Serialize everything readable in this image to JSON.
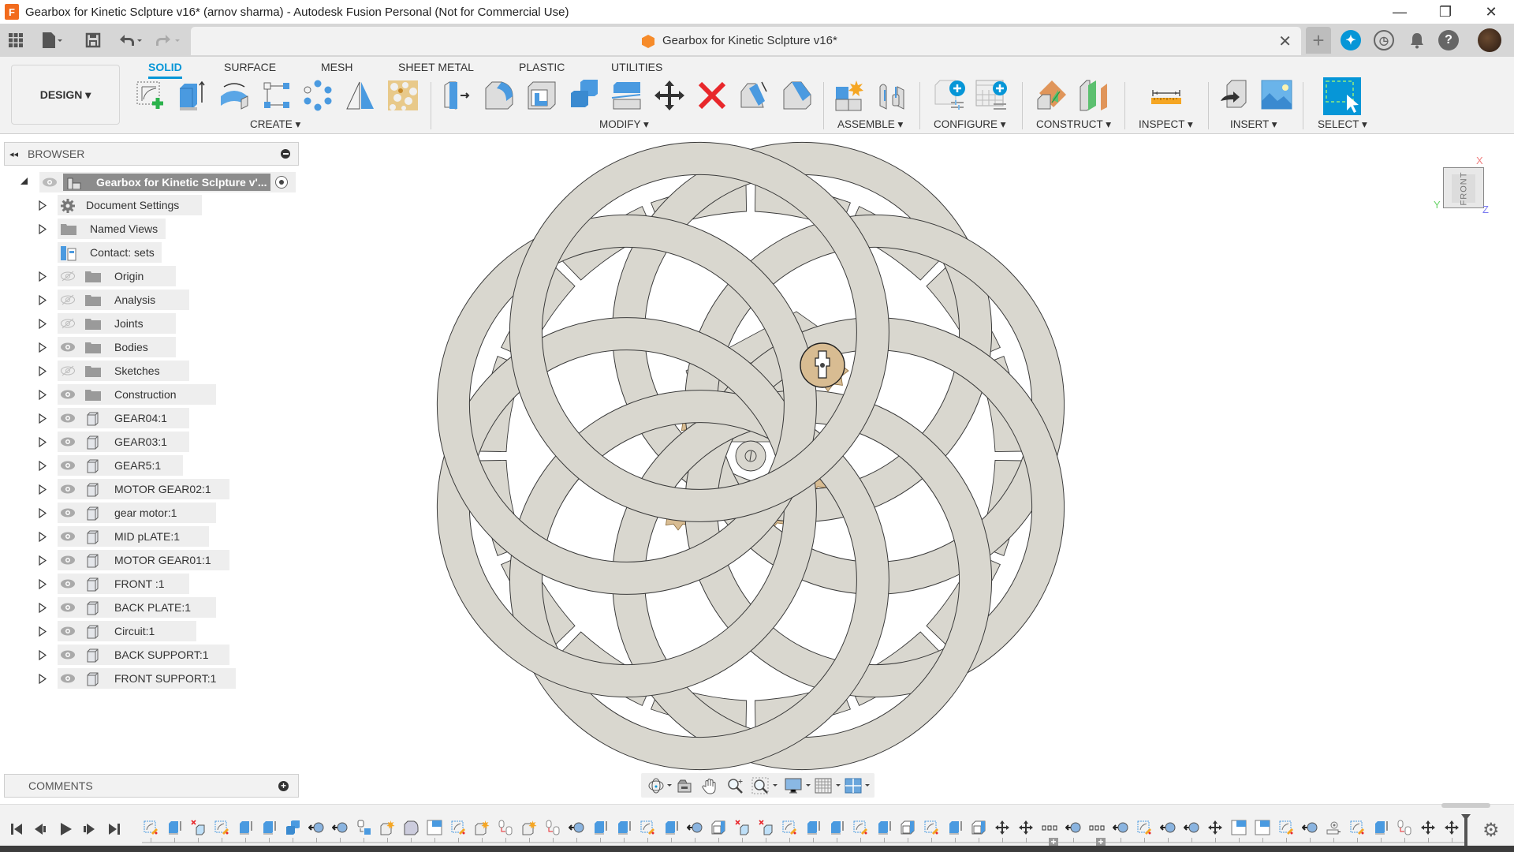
{
  "window": {
    "app_icon_letter": "F",
    "title": "Gearbox for Kinetic Sclpture v16* (arnov sharma) - Autodesk Fusion Personal (Not for Commercial Use)",
    "minimize": "—",
    "maximize": "❐",
    "close": "✕"
  },
  "quickbar": {
    "grid_icon": "▦",
    "file_icon": "▮",
    "save_icon": "💾",
    "undo_icon": "↶",
    "redo_icon": "↷",
    "dropdown": "▾"
  },
  "document_tab": {
    "title": "Gearbox for Kinetic Sclpture v16*",
    "close": "✕",
    "new_tab": "+"
  },
  "top_right": {
    "extensions_icon": "✦",
    "job_status_icon": "◷",
    "notifications_icon": "🔔",
    "help_icon": "?"
  },
  "ribbon": {
    "workspace": "DESIGN ▾",
    "tabs": [
      {
        "label": "SOLID",
        "active": true
      },
      {
        "label": "SURFACE",
        "active": false
      },
      {
        "label": "MESH",
        "active": false
      },
      {
        "label": "SHEET METAL",
        "active": false
      },
      {
        "label": "PLASTIC",
        "active": false
      },
      {
        "label": "UTILITIES",
        "active": false
      }
    ],
    "groups": [
      {
        "label": "CREATE ▾"
      },
      {
        "label": "MODIFY ▾"
      },
      {
        "label": "ASSEMBLE ▾"
      },
      {
        "label": "CONFIGURE ▾"
      },
      {
        "label": "CONSTRUCT ▾"
      },
      {
        "label": "INSPECT ▾"
      },
      {
        "label": "INSERT ▾"
      },
      {
        "label": "SELECT ▾"
      }
    ],
    "tools": {
      "create": [
        "create-sketch",
        "extrude",
        "revolve",
        "rectangular-pattern",
        "circular-pattern",
        "mirror",
        "volumetric-lattice"
      ],
      "modify": [
        "press-pull",
        "fillet",
        "shell",
        "combine",
        "split-body",
        "move-copy",
        "delete",
        "draft",
        "chamfer"
      ],
      "assemble": [
        "new-component",
        "joint"
      ],
      "configure": [
        "configure-design",
        "configuration-table"
      ],
      "construct": [
        "offset-plane",
        "midplane"
      ],
      "inspect": [
        "measure"
      ],
      "insert": [
        "insert-derive",
        "canvas"
      ],
      "select": [
        "window-select"
      ]
    }
  },
  "browser": {
    "title": "BROWSER",
    "collapse_icon": "◂◂",
    "root": "Gearbox for Kinetic Sclpture v'...",
    "items": [
      {
        "label": "Document Settings",
        "icon": "gear",
        "eye": "none",
        "expandable": true
      },
      {
        "label": "Named Views",
        "icon": "folder",
        "eye": "none",
        "expandable": true
      },
      {
        "label": "Contact: sets",
        "icon": "contact",
        "eye": "none",
        "expandable": false
      },
      {
        "label": "Origin",
        "icon": "folder",
        "eye": "hidden",
        "expandable": true
      },
      {
        "label": "Analysis",
        "icon": "folder",
        "eye": "hidden",
        "expandable": true
      },
      {
        "label": "Joints",
        "icon": "folder",
        "eye": "hidden",
        "expandable": true
      },
      {
        "label": "Bodies",
        "icon": "folder",
        "eye": "visible",
        "expandable": true
      },
      {
        "label": "Sketches",
        "icon": "folder",
        "eye": "hidden",
        "expandable": true
      },
      {
        "label": "Construction",
        "icon": "folder",
        "eye": "visible",
        "expandable": true
      },
      {
        "label": "GEAR04:1",
        "icon": "component",
        "eye": "visible",
        "expandable": true
      },
      {
        "label": "GEAR03:1",
        "icon": "component",
        "eye": "visible",
        "expandable": true
      },
      {
        "label": "GEAR5:1",
        "icon": "component",
        "eye": "visible",
        "expandable": true
      },
      {
        "label": "MOTOR GEAR02:1",
        "icon": "component",
        "eye": "visible",
        "expandable": true
      },
      {
        "label": "gear motor:1",
        "icon": "component",
        "eye": "visible",
        "expandable": true
      },
      {
        "label": "MID pLATE:1",
        "icon": "component",
        "eye": "visible",
        "expandable": true
      },
      {
        "label": "MOTOR GEAR01:1",
        "icon": "component",
        "eye": "visible",
        "expandable": true
      },
      {
        "label": "FRONT :1",
        "icon": "component",
        "eye": "visible",
        "expandable": true
      },
      {
        "label": "BACK PLATE:1",
        "icon": "component",
        "eye": "visible",
        "expandable": true
      },
      {
        "label": "Circuit:1",
        "icon": "component",
        "eye": "visible",
        "expandable": true
      },
      {
        "label": "BACK SUPPORT:1",
        "icon": "component",
        "eye": "visible",
        "expandable": true
      },
      {
        "label": "FRONT SUPPORT:1",
        "icon": "component",
        "eye": "visible",
        "expandable": true
      }
    ]
  },
  "comments": {
    "title": "COMMENTS",
    "add_icon": "+"
  },
  "viewcube": {
    "face": "FRONT",
    "x_axis": "X",
    "y_axis": "Y",
    "z_axis": "Z"
  },
  "navbar": [
    "orbit",
    "look-at",
    "pan",
    "zoom",
    "fit",
    "display-settings",
    "grid-snaps",
    "viewports"
  ],
  "timeline": {
    "controls": [
      "⏮",
      "◀",
      "▶",
      "▶|",
      "⏭"
    ],
    "features": [
      "sketch",
      "extrude",
      "remove",
      "sketch",
      "extrude",
      "extrude",
      "combine",
      "joint",
      "joint",
      "align",
      "new-comp",
      "fillet",
      "plane",
      "sketch",
      "new-comp",
      "rigid",
      "new-comp",
      "rigid",
      "joint",
      "extrude",
      "extrude",
      "sketch",
      "extrude",
      "joint",
      "shell",
      "remove",
      "remove",
      "sketch",
      "extrude",
      "extrude",
      "sketch",
      "extrude",
      "shell",
      "sketch",
      "extrude",
      "shell",
      "move",
      "move",
      "pattern",
      "joint",
      "pattern",
      "joint",
      "sketch",
      "joint",
      "joint",
      "move",
      "plane",
      "plane",
      "sketch",
      "joint",
      "motion",
      "sketch",
      "extrude",
      "rigid",
      "move",
      "move"
    ],
    "settings_icon": "⚙"
  },
  "colors": {
    "accent": "#0696d7",
    "model_fill": "#d9d7cf",
    "gear_fill": "#d8bc92",
    "delete_red": "#e8272b"
  }
}
